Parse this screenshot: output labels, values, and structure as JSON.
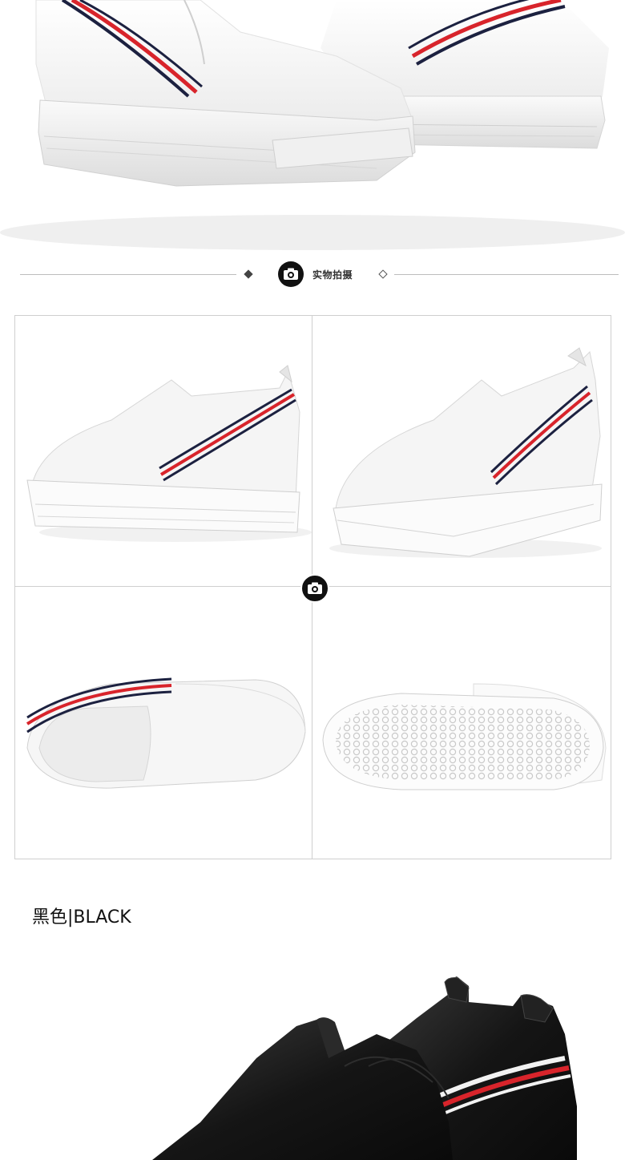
{
  "divider": {
    "label": "实物拍摄"
  },
  "icons": {
    "camera": "camera-icon",
    "diamond_filled": "diamond-filled-icon",
    "diamond_outline": "diamond-outline-icon"
  },
  "color_variant": {
    "label": "黑色|BLACK"
  },
  "colors": {
    "stripe_red": "#d8242b",
    "stripe_navy": "#1c2140",
    "shoe_white": "#f4f4f4",
    "shoe_black": "#141414",
    "divider_line": "#bdbdbd"
  }
}
